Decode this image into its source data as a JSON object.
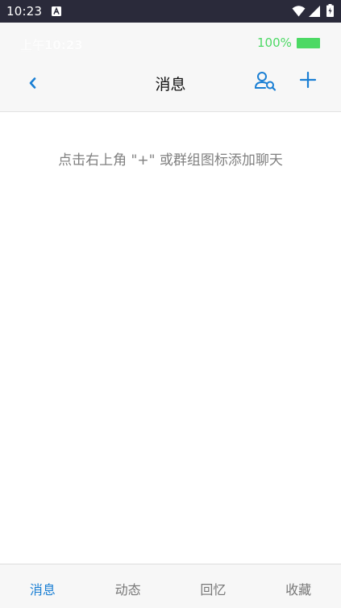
{
  "system_status": {
    "time": "10:23"
  },
  "app_status": {
    "time": "上午10:23",
    "battery_text": "100%",
    "battery_color": "#4cd964"
  },
  "header": {
    "title": "消息",
    "back_icon": "chevron-left-icon",
    "contacts_icon": "contacts-search-icon",
    "add_icon": "plus-icon",
    "accent_color": "#1a7fd4"
  },
  "main": {
    "empty_hint": "点击右上角 \"+\" 或群组图标添加聊天"
  },
  "tabs": [
    {
      "label": "消息",
      "active": true
    },
    {
      "label": "动态",
      "active": false
    },
    {
      "label": "回忆",
      "active": false
    },
    {
      "label": "收藏",
      "active": false
    }
  ]
}
